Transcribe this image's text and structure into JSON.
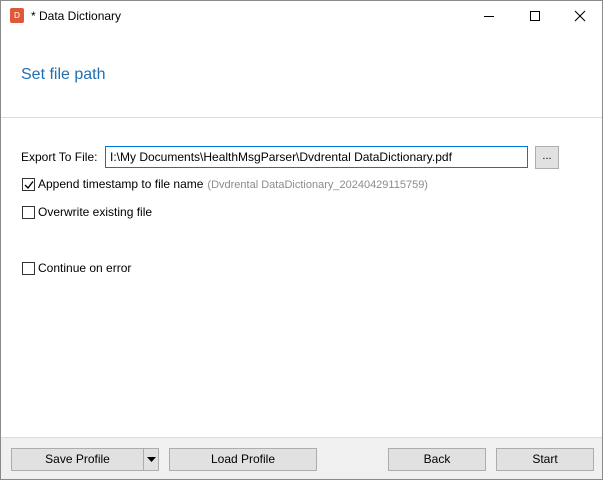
{
  "window": {
    "title": "* Data Dictionary",
    "app_icon": "app-logo-icon",
    "controls": [
      "minimize-icon",
      "maximize-icon",
      "close-icon"
    ]
  },
  "header": {
    "title": "Set file path"
  },
  "export": {
    "label": "Export To File:",
    "path_value": "I:\\My Documents\\HealthMsgParser\\Dvdrental DataDictionary.pdf",
    "browse_label": "..."
  },
  "options": {
    "append_timestamp": {
      "label": "Append timestamp to file name",
      "checked": true,
      "hint": "(Dvdrental DataDictionary_20240429115759)"
    },
    "overwrite": {
      "label": "Overwrite existing file",
      "checked": false
    },
    "continue_on_error": {
      "label": "Continue on error",
      "checked": false
    }
  },
  "footer": {
    "save_profile": "Save Profile",
    "load_profile": "Load Profile",
    "back": "Back",
    "start": "Start"
  },
  "colors": {
    "title_accent": "#1f6fb2",
    "input_focus_border": "#0078d7",
    "button_face": "#e1e1e1",
    "hint_text": "#8c8c8c"
  }
}
